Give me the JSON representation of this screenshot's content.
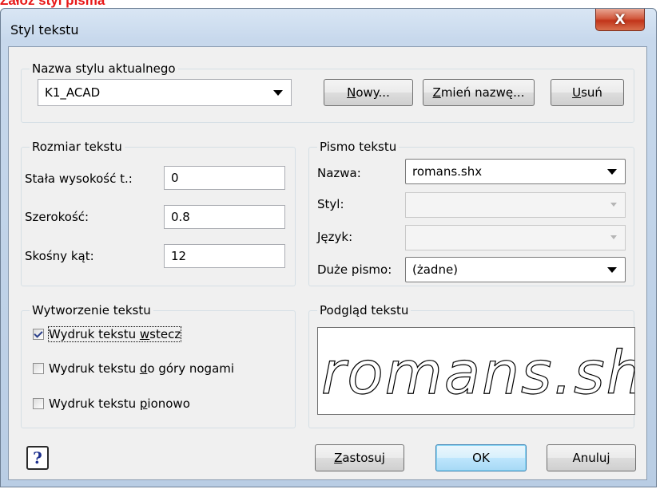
{
  "caption": "Załóż styl pisma",
  "window": {
    "title": "Styl tekstu",
    "close_glyph": "X"
  },
  "style_name": {
    "group_label": "Nazwa stylu aktualnego",
    "value": "K1_ACAD",
    "buttons": [
      {
        "pre": "",
        "key": "N",
        "post": "owy..."
      },
      {
        "pre": "",
        "key": "Z",
        "post": "mień nazwę..."
      },
      {
        "pre": "",
        "key": "U",
        "post": "suń"
      }
    ]
  },
  "text_size": {
    "group_label": "Rozmiar tekstu",
    "fields": [
      {
        "label": "Stała wysokość t.:",
        "value": "0"
      },
      {
        "label": "Szerokość:",
        "value": "0.8"
      },
      {
        "label": "Skośny kąt:",
        "value": "12"
      }
    ]
  },
  "font": {
    "group_label": "Pismo tekstu",
    "name_label": "Nazwa:",
    "name_value": "romans.shx",
    "style_label": "Styl:",
    "style_value": "",
    "language_label": "Język:",
    "language_value": "",
    "bigfont_label": "Duże pismo:",
    "bigfont_value": "(żadne)"
  },
  "generation": {
    "group_label": "Wytworzenie tekstu",
    "options": [
      {
        "pre": "Wydruk tekstu ",
        "key": "w",
        "post": "stecz",
        "checked": true
      },
      {
        "pre": "Wydruk tekstu ",
        "key": "d",
        "post": "o góry nogami",
        "checked": false
      },
      {
        "pre": "Wydruk tekstu ",
        "key": "p",
        "post": "ionowo",
        "checked": false
      }
    ]
  },
  "preview": {
    "group_label": "Podgląd tekstu",
    "text": "romans.shx"
  },
  "footer": {
    "help_glyph": "?",
    "apply": {
      "pre": "",
      "key": "Z",
      "post": "astosuj"
    },
    "ok": "OK",
    "cancel": {
      "pre": "Anulu",
      "key": "j",
      "post": ""
    }
  }
}
